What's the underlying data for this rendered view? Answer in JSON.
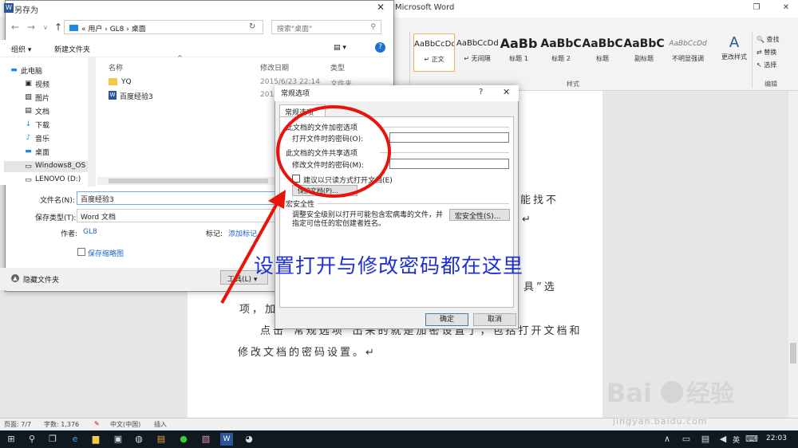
{
  "word": {
    "title": "Microsoft Word",
    "styles": [
      {
        "sample": "AaBbCcDd",
        "name": "↵ 正文",
        "selected": true
      },
      {
        "sample": "AaBbCcDd",
        "name": "↵ 无间隔"
      },
      {
        "sample": "AaBb",
        "name": "标题 1"
      },
      {
        "sample": "AaBbC",
        "name": "标题 2"
      },
      {
        "sample": "AaBbC",
        "name": "标题"
      },
      {
        "sample": "AaBbC",
        "name": "副标题"
      },
      {
        "sample": "AaBbCcDd",
        "name": "不明显强调"
      }
    ],
    "change_style": "更改样式",
    "styles_group": "样式",
    "editing": {
      "find": "查找",
      "replace": "替换",
      "select": "选择",
      "group": "编辑"
    },
    "doc_lines": [
      "能找不",
      "↵",
      "具”选",
      "项，加密",
      "点击“常规选项”出来的就是加密设置了，包括打开文档和",
      "修改文档的密码设置。↵"
    ],
    "status": {
      "page": "页面: 7/7",
      "words": "字数: 1,376",
      "lang": "中文(中国)",
      "mode": "插入"
    }
  },
  "taskbar": {
    "time": "22:03",
    "ime": "英"
  },
  "save_as": {
    "title": "另存为",
    "breadcrumb": "« 用户 › GL8 › 桌面",
    "search_placeholder": "搜索\"桌面\"",
    "toolbar": {
      "organize": "组织 ▾",
      "new_folder": "新建文件夹"
    },
    "nav": [
      "此电脑",
      "视频",
      "图片",
      "文档",
      "下载",
      "音乐",
      "桌面",
      "Windows8_OS",
      "LENOVO (D:)"
    ],
    "columns": {
      "name": "名称",
      "date": "修改日期",
      "type": "类型"
    },
    "files": [
      {
        "name": "YQ",
        "date": "2015/6/23 22:14",
        "type": "文件夹"
      },
      {
        "name": "百度经验3",
        "date": "2015/",
        "type": ""
      }
    ],
    "filename_label": "文件名(N):",
    "filename_value": "百度经验3",
    "filetype_label": "保存类型(T):",
    "filetype_value": "Word 文档",
    "author_label": "作者:",
    "author_value": "GL8",
    "tag_label": "标记:",
    "tag_value": "添加标记",
    "thumbnail_label": "保存缩略图",
    "hide_folders": "隐藏文件夹",
    "tools_button": "工具(L) ▾"
  },
  "general_options": {
    "title": "常规选项",
    "help": "?",
    "tab": "常规选项",
    "encrypt_section": "此文档的文件加密选项",
    "open_password_label": "打开文件时的密码(O):",
    "share_section": "此文档的文件共享选项",
    "modify_password_label": "修改文件时的密码(M):",
    "readonly_label": "建议以只读方式打开文档(E)",
    "protect_button": "保护文档(P)...",
    "macro_section": "宏安全性",
    "macro_desc_1": "调整安全级别以打开可能包含宏病毒的文件，并",
    "macro_desc_2": "指定可信任的宏创建者姓名。",
    "macro_button": "宏安全性(S)...",
    "ok": "确定",
    "cancel": "取消"
  },
  "annotation": {
    "text": "设置打开与修改密码都在这里",
    "color": "#1d2fd8"
  },
  "watermark": {
    "logo_text": "Bai经验",
    "site": "jingyan.baidu.com"
  }
}
